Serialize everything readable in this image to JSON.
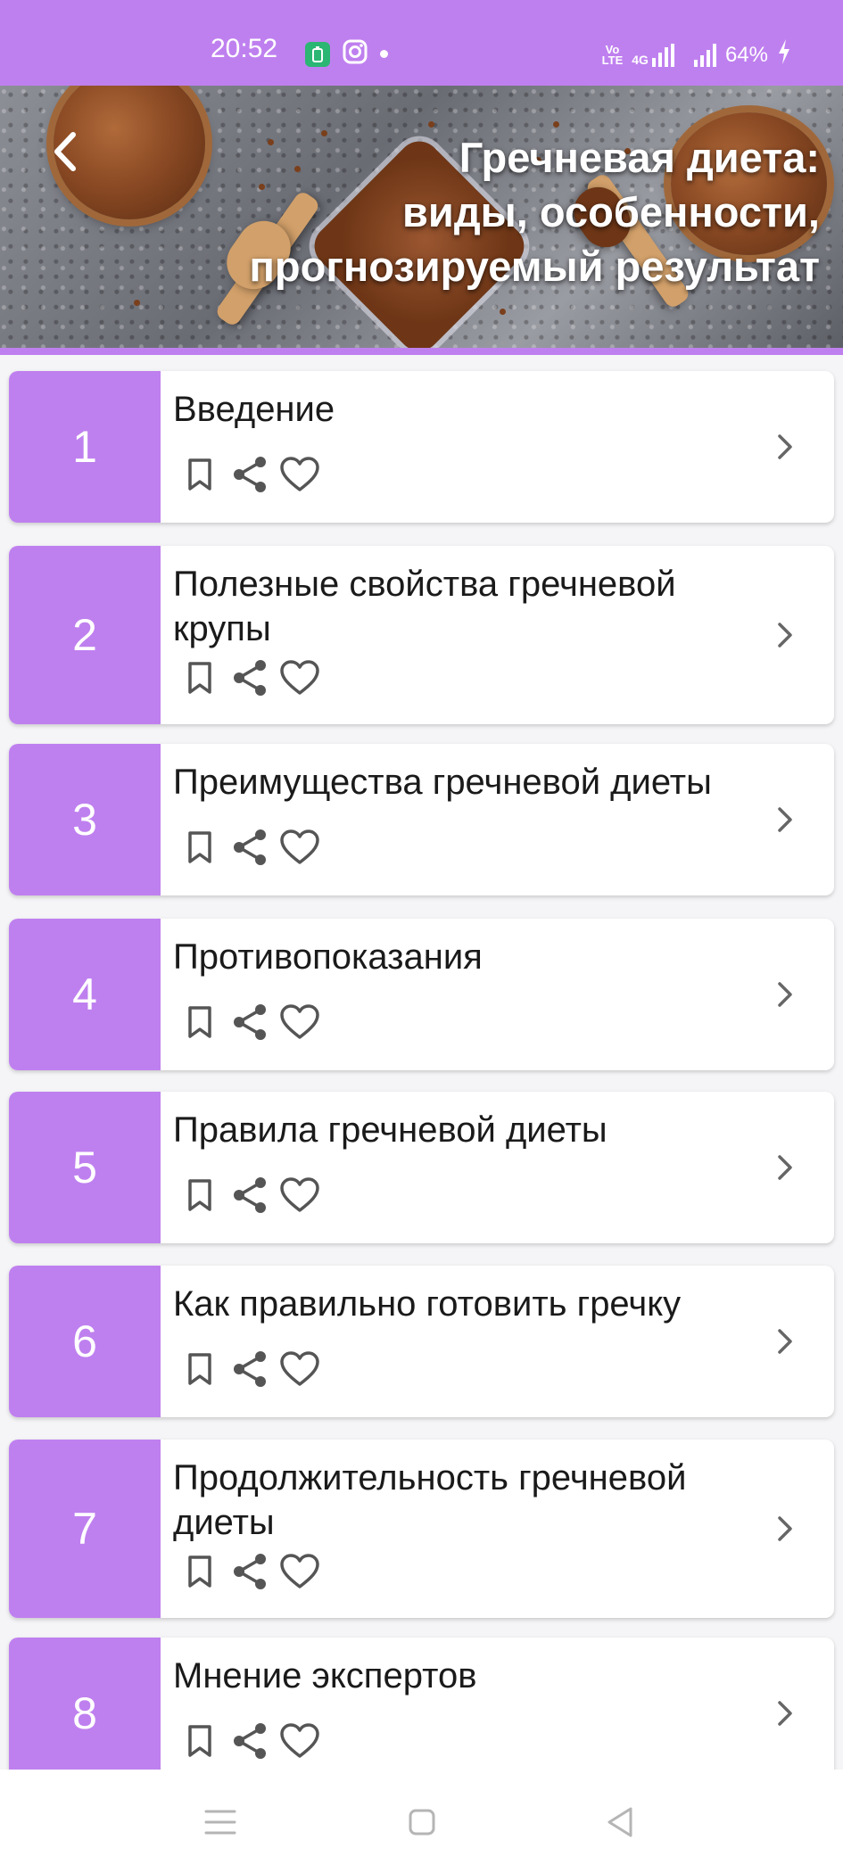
{
  "status_bar": {
    "time": "20:52",
    "network_tag_top": "Vo",
    "network_tag_bottom": "LTE",
    "network_type": "4G",
    "battery": "64%"
  },
  "header": {
    "title": "Гречневая диета:\nвиды, особенности,\nпрогнозируемый результат",
    "back_icon": "chevron-left-icon"
  },
  "accent_color": "#bf80ef",
  "chapters": [
    {
      "number": "1",
      "title": "Введение"
    },
    {
      "number": "2",
      "title": "Полезные свойства гречневой крупы"
    },
    {
      "number": "3",
      "title": "Преимущества гречневой диеты"
    },
    {
      "number": "4",
      "title": "Противопоказания"
    },
    {
      "number": "5",
      "title": "Правила гречневой диеты"
    },
    {
      "number": "6",
      "title": "Как правильно готовить гречку"
    },
    {
      "number": "7",
      "title": "Продолжительность гречневой диеты"
    },
    {
      "number": "8",
      "title": "Мнение экспертов"
    }
  ],
  "card_icons": [
    "bookmark-icon",
    "share-icon",
    "heart-icon",
    "chevron-right-icon"
  ],
  "nav_bar": [
    "menu-icon",
    "home-icon",
    "back-icon"
  ]
}
